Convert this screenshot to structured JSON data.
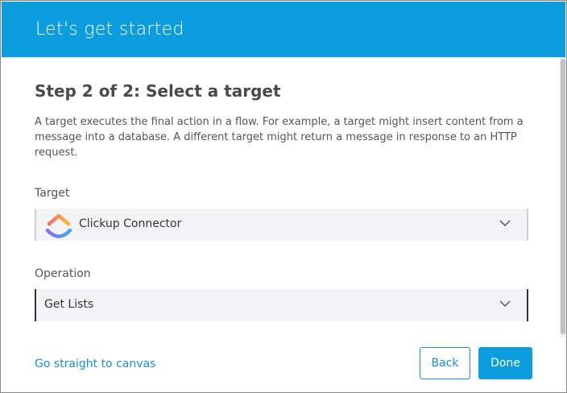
{
  "header": {
    "title": "Let's get started"
  },
  "step": {
    "title": "Step 2 of 2: Select a target",
    "description": "A target executes the final action in a flow. For example, a target might insert content from a message into a database. A different target might return a message in response to an HTTP request."
  },
  "target": {
    "label": "Target",
    "value": "Clickup Connector",
    "icon": "clickup-logo-icon"
  },
  "operation": {
    "label": "Operation",
    "value": "Get Lists"
  },
  "footer": {
    "link": "Go straight to canvas",
    "back_label": "Back",
    "done_label": "Done"
  },
  "colors": {
    "header_bg": "#0b9ddd",
    "link": "#1a8fd1",
    "primary_button": "#0b9ddd"
  }
}
